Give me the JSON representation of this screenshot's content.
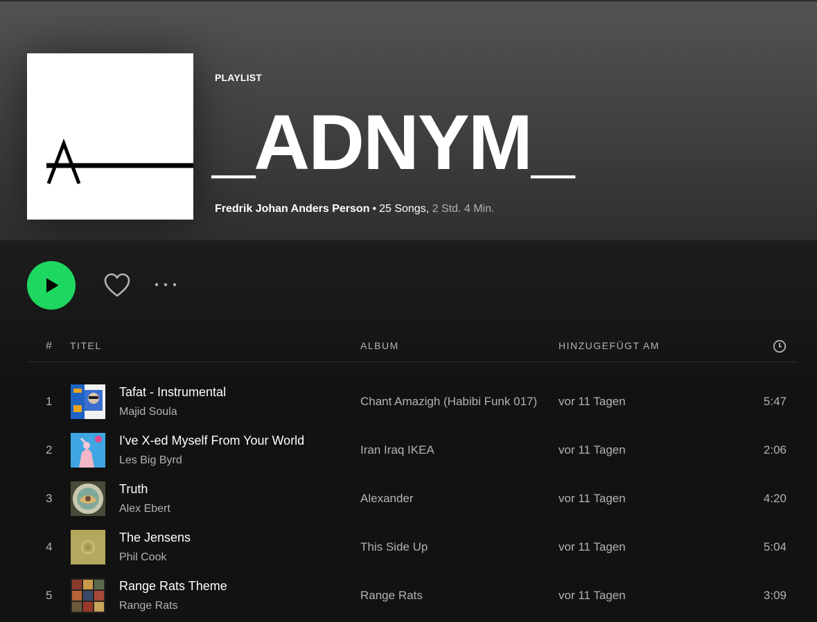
{
  "playlist": {
    "type_label": "PLAYLIST",
    "title": "_ADNYM_",
    "owner": "Fredrik Johan Anders Person",
    "separator": "•",
    "song_count": "25 Songs,",
    "duration": "2 Std. 4 Min."
  },
  "icons": {
    "play": "play-icon",
    "heart": "heart-icon",
    "more": "more-horizontal-icon",
    "clock": "clock-icon"
  },
  "colors": {
    "accent": "#1ed760",
    "background": "#121212",
    "header_top": "#535353",
    "text_secondary": "#b3b3b3"
  },
  "table": {
    "headers": {
      "number": "#",
      "title": "TITEL",
      "album": "ALBUM",
      "added": "HINZUGEFÜGT AM"
    },
    "rows": [
      {
        "number": "1",
        "title": "Tafat - Instrumental",
        "artist": "Majid Soula",
        "album": "Chant Amazigh (Habibi Funk 017)",
        "added": "vor 11 Tagen",
        "duration": "5:47"
      },
      {
        "number": "2",
        "title": "I've X-ed Myself From Your World",
        "artist": "Les Big Byrd",
        "album": "Iran Iraq IKEA",
        "added": "vor 11 Tagen",
        "duration": "2:06"
      },
      {
        "number": "3",
        "title": "Truth",
        "artist": "Alex Ebert",
        "album": "Alexander",
        "added": "vor 11 Tagen",
        "duration": "4:20"
      },
      {
        "number": "4",
        "title": "The Jensens",
        "artist": "Phil Cook",
        "album": "This Side Up",
        "added": "vor 11 Tagen",
        "duration": "5:04"
      },
      {
        "number": "5",
        "title": "Range Rats Theme",
        "artist": "Range Rats",
        "album": "Range Rats",
        "added": "vor 11 Tagen",
        "duration": "3:09"
      }
    ]
  }
}
